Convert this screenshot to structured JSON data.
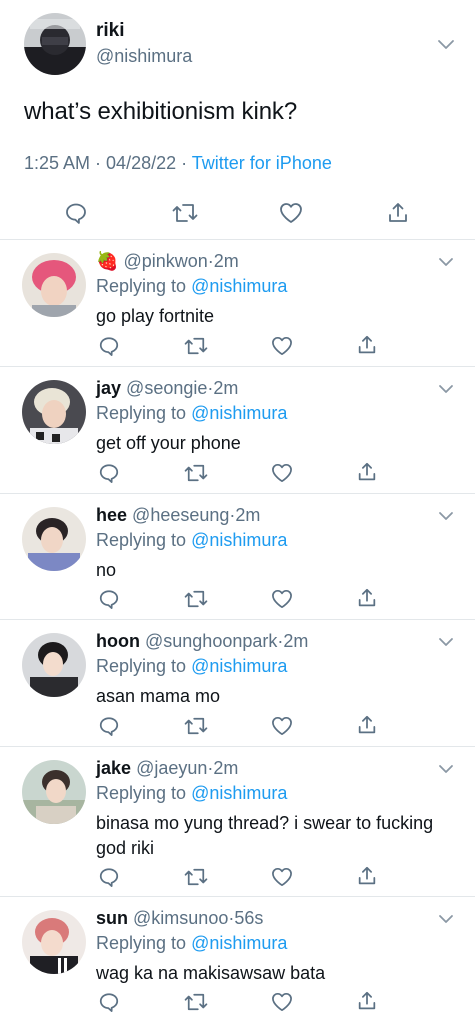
{
  "main_tweet": {
    "display_name": "riki",
    "handle": "@nishimura",
    "text": "what’s exhibitionism kink?",
    "time": "1:25 AM",
    "sep": " · ",
    "date": "04/28/22",
    "sep2": " · ",
    "source": "Twitter for iPhone"
  },
  "replying_prefix": "Replying to",
  "replies": [
    {
      "display_name": "",
      "emoji": "🍓",
      "handle": "@pinkwon",
      "sep": "·",
      "time": "2m",
      "replying_to": "@nishimura",
      "text": "go play fortnite",
      "avatar_color": "#e5577c"
    },
    {
      "display_name": "jay",
      "handle": "@seongie",
      "sep": "·",
      "time": "2m",
      "replying_to": "@nishimura",
      "text": "get off your phone",
      "avatar_color": "#d8d2c6"
    },
    {
      "display_name": "hee",
      "handle": "@heeseung",
      "sep": "·",
      "time": "2m",
      "replying_to": "@nishimura",
      "text": "no",
      "avatar_color": "#7c88c4"
    },
    {
      "display_name": "hoon",
      "handle": "@sunghoonpark",
      "sep": "·",
      "time": "2m",
      "replying_to": "@nishimura",
      "text": "asan mama mo",
      "avatar_color": "#2b2b2f"
    },
    {
      "display_name": "jake",
      "handle": "@jaeyun",
      "sep": "·",
      "time": "2m",
      "replying_to": "@nishimura",
      "text": "binasa mo yung thread? i swear to fucking god riki",
      "avatar_color": "#a7b5a0"
    },
    {
      "display_name": "sun",
      "handle": "@kimsunoo",
      "sep": "·",
      "time": "56s",
      "replying_to": "@nishimura",
      "text": "wag ka na makisawsaw bata",
      "avatar_color": "#d97a7a"
    }
  ],
  "colors": {
    "accent": "#1d9bf0",
    "muted": "#5b7083",
    "text": "#0f1419",
    "divider": "#e3e7ea"
  },
  "icons": [
    "reply-icon",
    "retweet-icon",
    "like-icon",
    "share-icon",
    "chevron-down-icon"
  ]
}
